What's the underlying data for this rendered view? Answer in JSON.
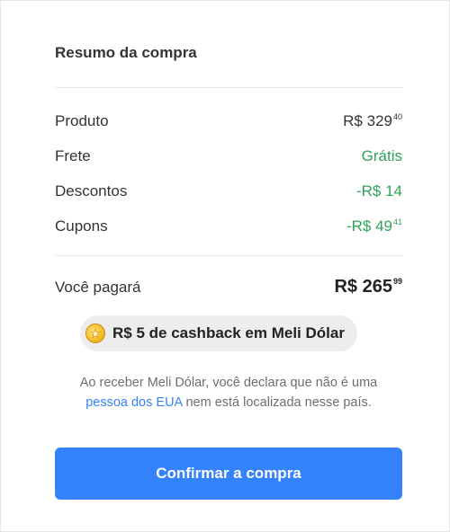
{
  "summary": {
    "title": "Resumo da compra",
    "rows": [
      {
        "label": "Produto",
        "value_main": "R$ 329",
        "value_cents": "40"
      },
      {
        "label": "Frete",
        "value_main": "Grátis",
        "value_cents": ""
      },
      {
        "label": "Descontos",
        "value_main": "-R$ 14",
        "value_cents": ""
      },
      {
        "label": "Cupons",
        "value_main": "-R$ 49",
        "value_cents": "41"
      }
    ],
    "total": {
      "label": "Você pagará",
      "value_main": "R$ 265",
      "value_cents": "99"
    }
  },
  "cashback": {
    "icon": "coin-icon",
    "text": "R$ 5 de cashback em Meli Dólar"
  },
  "disclaimer": {
    "part1": "Ao receber Meli Dólar, você declara que não é uma",
    "link": "pessoa dos EUA",
    "part2": "nem está localizada nesse país."
  },
  "actions": {
    "confirm_label": "Confirmar a compra"
  },
  "colors": {
    "accent": "#3483fa",
    "green": "#2fa35a"
  }
}
